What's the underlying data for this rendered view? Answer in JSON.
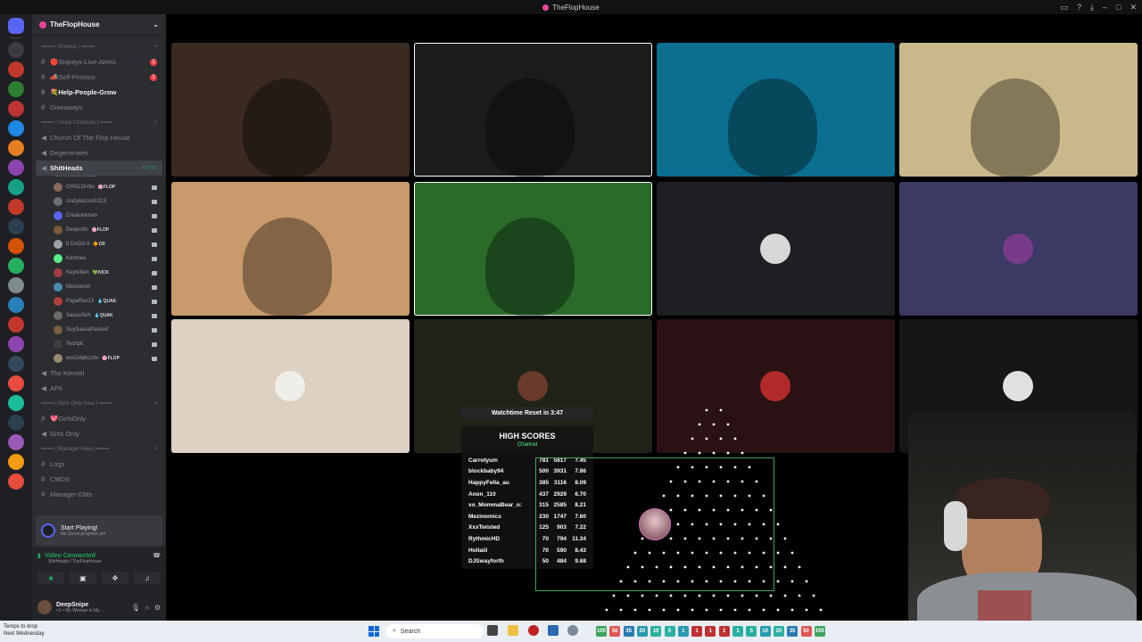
{
  "window": {
    "title": "TheFlopHouse"
  },
  "guild": {
    "name": "TheFlopHouse"
  },
  "channels": [
    {
      "kind": "cat",
      "label": "━━━━ | Promos | ━━━━"
    },
    {
      "kind": "text",
      "label": "🔴Snipeys-Live-Alerts",
      "badge": "1"
    },
    {
      "kind": "text",
      "label": "📣Self-Promos",
      "badge": "1"
    },
    {
      "kind": "text",
      "label": "💐Help-People-Grow",
      "bright": true
    },
    {
      "kind": "text",
      "label": "Giveaways"
    },
    {
      "kind": "cat",
      "label": "━━━━ | Voice Channels | ━━━━"
    },
    {
      "kind": "voice",
      "label": "Church Of The Flop House"
    },
    {
      "kind": "voice",
      "label": "Degenerates"
    },
    {
      "kind": "voice",
      "label": "ShitHeads",
      "active": true,
      "timer": "4:27:47",
      "status": "Set a channel status"
    }
  ],
  "voice_users": [
    {
      "name": "CHOLOrrito",
      "tag": "🌸FLOP",
      "color": "#8a6a5a"
    },
    {
      "name": "crazykazool1313",
      "tag": "",
      "color": "#6b6f78"
    },
    {
      "name": "Creatureman",
      "tag": "",
      "color": "#5865f2"
    },
    {
      "name": "Deeprrito",
      "tag": "🌸FLOP",
      "color": "#7a5a3a"
    },
    {
      "name": "II DADA II",
      "tag": "🔶CR",
      "color": "#9aa0a6"
    },
    {
      "name": "Kermiee",
      "tag": "",
      "color": "#57f287"
    },
    {
      "name": "KeyKitten",
      "tag": "💚KICK",
      "color": "#a04040"
    },
    {
      "name": "Mexsterio!",
      "tag": "",
      "color": "#4a8ab0"
    },
    {
      "name": "PapaRex13",
      "tag": "💧QUAK",
      "color": "#b04040"
    },
    {
      "name": "SauceSuh",
      "tag": "💧QUAK",
      "color": "#6a6a6a"
    },
    {
      "name": "SoySaucePacked",
      "tag": "",
      "color": "#7a6040"
    },
    {
      "name": "Techplt",
      "tag": "",
      "color": "#404040"
    },
    {
      "name": "woo2dahizzle",
      "tag": "🌸FLOP",
      "color": "#9a8a70"
    }
  ],
  "channels_lower": [
    {
      "kind": "voice",
      "label": "The Kennel"
    },
    {
      "kind": "voice",
      "label": "AFK"
    },
    {
      "kind": "cat",
      "label": "━━━━ | Girls Only Area | ━━━━"
    },
    {
      "kind": "text",
      "label": "💖GirlsOnly"
    },
    {
      "kind": "voice",
      "label": "Girls Only"
    },
    {
      "kind": "cat",
      "label": "━━━━ | Manager Area | ━━━━"
    },
    {
      "kind": "text",
      "label": "Logs"
    },
    {
      "kind": "text",
      "label": "CMDS"
    },
    {
      "kind": "text",
      "label": "Manager-DMs"
    }
  ],
  "ongoing": {
    "title": "Start Playing!",
    "sub": "No Quest progress yet"
  },
  "voice_status": {
    "state": "Video Connected",
    "where": "ShitHeads / TheFlopHouse"
  },
  "user": {
    "name": "DeepSnipe",
    "status": "+1 • My Woman Is My ..."
  },
  "tiles": [
    {
      "label": "cam-tile-1",
      "bg": "#3a2a22"
    },
    {
      "label": "cam-tile-2",
      "bg": "#1a1c1e",
      "speaking": true
    },
    {
      "label": "cam-tile-3",
      "bg": "#0b6f8f"
    },
    {
      "label": "cam-tile-4",
      "bg": "#c9b98a"
    },
    {
      "label": "cam-tile-5",
      "bg": "#c89a6c"
    },
    {
      "label": "cam-tile-6",
      "bg": "#2a6b2a",
      "speaking": true
    },
    {
      "label": "avatar-tile-7",
      "bg": "#1e1f22",
      "face": "#d8d8d8"
    },
    {
      "label": "avatar-tile-8",
      "bg": "#3b3a64",
      "face": "#7a3a8a"
    },
    {
      "label": "avatar-tile-9",
      "bg": "#dcd1c2",
      "face": "#f0eee8"
    },
    {
      "label": "avatar-tile-10",
      "bg": "#1f2318",
      "face": "#6a3a2a"
    },
    {
      "label": "avatar-tile-11",
      "bg": "#2a1214",
      "face": "#b02a2a"
    },
    {
      "label": "avatar-tile-12",
      "bg": "#161616",
      "face": "#e0e0e0"
    }
  ],
  "game": {
    "watchtime": "Watchtime Reset in 3:47",
    "title": "HIGH SCORES",
    "subtitle": "Channel",
    "scores": [
      [
        "Carrotyum",
        "781",
        "5817",
        "7.45"
      ],
      [
        "blockbaby94",
        "500",
        "3931",
        "7.86"
      ],
      [
        "HappyFella_au",
        "385",
        "3116",
        "8.09"
      ],
      [
        "Anon_110",
        "437",
        "2929",
        "6.70"
      ],
      [
        "xo_MommaBear_o:",
        "315",
        "2585",
        "8.21"
      ],
      [
        "Mezinomics",
        "230",
        "1747",
        "7.60"
      ],
      [
        "XxxTwisted",
        "125",
        "903",
        "7.22"
      ],
      [
        "RythmicHD",
        "70",
        "794",
        "11.34"
      ],
      [
        "Hollaiii",
        "70",
        "590",
        "8.43"
      ],
      [
        "DJSwayforth",
        "50",
        "484",
        "9.68"
      ]
    ]
  },
  "taskbar": {
    "weather_1": "Temps to drop",
    "weather_2": "Next Wednesday",
    "search": "Search",
    "tray": [
      "100",
      "50",
      "35",
      "20",
      "10",
      "5",
      "1",
      "1",
      "1",
      "1",
      "1",
      "5",
      "10",
      "20",
      "35",
      "50",
      "100"
    ],
    "tray_colors": [
      "#3ba55d",
      "#e05555",
      "#2a7ab0",
      "#2a9ab0",
      "#2ab0a0",
      "#2ab0a0",
      "#2a9ab0",
      "#c03030",
      "#c03030",
      "#c03030",
      "#2ab0a0",
      "#2ab0a0",
      "#2a9ab0",
      "#2ab0a0",
      "#2a7ab0",
      "#e05555",
      "#3ba55d"
    ]
  }
}
